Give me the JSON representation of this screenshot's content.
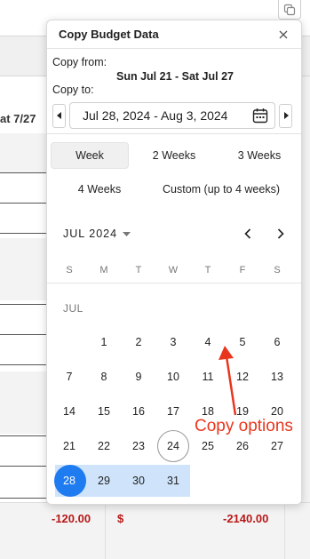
{
  "background": {
    "left_header": "at 7/27",
    "neg_value_1": "-120.00",
    "currency": "$",
    "neg_value_2": "-2140.00"
  },
  "dialog": {
    "title": "Copy Budget Data",
    "copy_from_label": "Copy from:",
    "copy_from_value": "Sun Jul 21 - Sat Jul 27",
    "copy_to_label": "Copy to:",
    "copy_to_value": "Jul 28, 2024 - Aug 3, 2024"
  },
  "options": {
    "week": "Week",
    "two_weeks": "2 Weeks",
    "three_weeks": "3 Weeks",
    "four_weeks": "4 Weeks",
    "custom": "Custom (up to 4 weeks)"
  },
  "calendar": {
    "month_label": "JUL 2024",
    "month_short": "JUL",
    "weekdays": [
      "S",
      "M",
      "T",
      "W",
      "T",
      "F",
      "S"
    ],
    "rows": [
      [
        "",
        "1",
        "2",
        "3",
        "4",
        "5",
        "6"
      ],
      [
        "7",
        "8",
        "9",
        "10",
        "11",
        "12",
        "13"
      ],
      [
        "14",
        "15",
        "16",
        "17",
        "18",
        "19",
        "20"
      ],
      [
        "21",
        "22",
        "23",
        "24",
        "25",
        "26",
        "27"
      ],
      [
        "28",
        "29",
        "30",
        "31",
        "",
        "",
        ""
      ]
    ],
    "today": "24",
    "selected_start": "28",
    "selected_range": [
      "28",
      "29",
      "30",
      "31"
    ]
  },
  "annotation": {
    "text": "Copy options",
    "color": "#e8361e"
  },
  "colors": {
    "accent": "#1e7bf0",
    "range_fill": "#cfe4fb",
    "negative": "#b81818"
  }
}
